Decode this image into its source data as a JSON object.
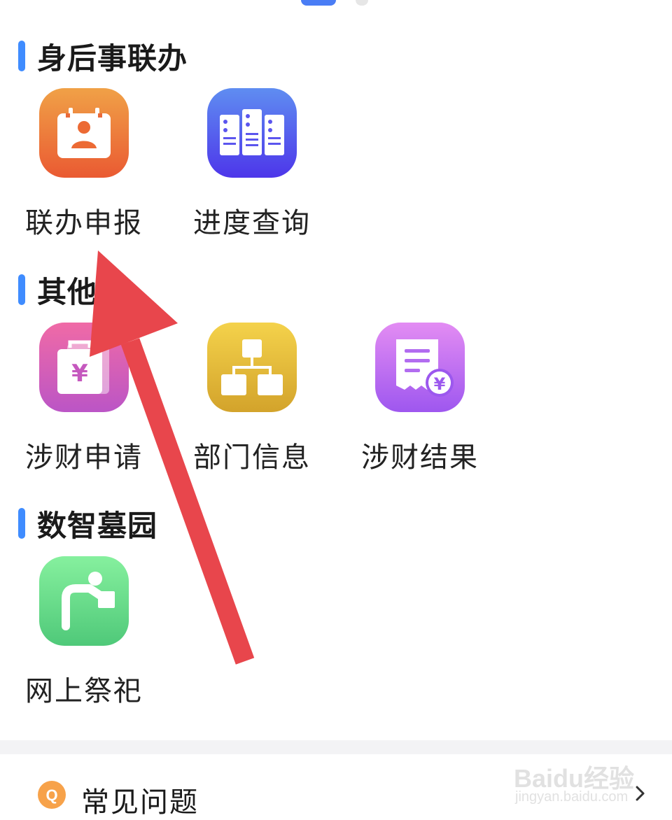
{
  "sections": [
    {
      "title": "身后事联办"
    },
    {
      "title": "其他"
    },
    {
      "title": "数智墓园"
    }
  ],
  "services": {
    "joint_application": "联办申报",
    "progress_query": "进度查询",
    "finance_application": "涉财申请",
    "department_info": "部门信息",
    "finance_result": "涉财结果",
    "online_memorial": "网上祭祀"
  },
  "faq": {
    "label": "常见问题"
  },
  "watermark": {
    "brand": "Baidu经验",
    "url": "jingyan.baidu.com"
  },
  "colors": {
    "section_bar": "#3f8cff",
    "arrow": "#e8464c",
    "pager_active": "#4a7df5"
  },
  "icons": {
    "joint_application": "person-card-icon",
    "progress_query": "server-racks-icon",
    "finance_application": "yuan-bag-icon",
    "department_info": "org-chart-icon",
    "finance_result": "receipt-yuan-icon",
    "online_memorial": "person-bowing-icon",
    "faq": "q-bubble-icon",
    "chevron": "chevron-right-icon"
  }
}
